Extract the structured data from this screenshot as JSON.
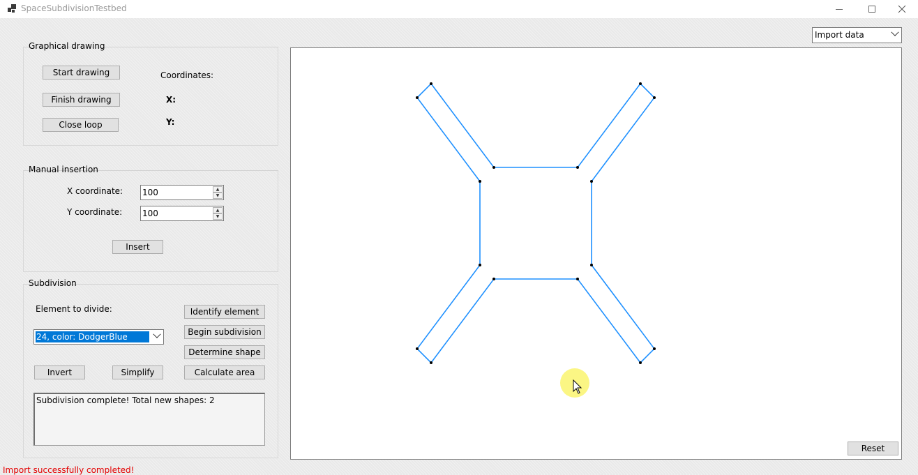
{
  "window": {
    "title": "SpaceSubdivisionTestbed"
  },
  "import_select": {
    "value": "Import data"
  },
  "graphical_drawing": {
    "title": "Graphical drawing",
    "start_label": "Start drawing",
    "finish_label": "Finish drawing",
    "close_label": "Close loop",
    "coordinates_label": "Coordinates:",
    "x_label": "X:",
    "y_label": "Y:"
  },
  "manual_insertion": {
    "title": "Manual insertion",
    "x_label": "X coordinate:",
    "x_value": "100",
    "y_label": "Y coordinate:",
    "y_value": "100",
    "insert_label": "Insert"
  },
  "subdivision": {
    "title": "Subdivision",
    "element_label": "Element to divide:",
    "element_value": "24, color: DodgerBlue",
    "identify_label": "Identify element",
    "begin_label": "Begin subdivision",
    "determine_label": "Determine shape",
    "invert_label": "Invert",
    "simplify_label": "Simplify",
    "calc_label": "Calculate area",
    "output_text": "Subdivision complete! Total new shapes: 2"
  },
  "canvas": {
    "reset_label": "Reset",
    "shape_color": "#1e90ff",
    "vertex_color": "#000000"
  },
  "status_text": "Import successfully completed!",
  "colors": {
    "status": "#e30000",
    "selection": "#0078d7"
  }
}
